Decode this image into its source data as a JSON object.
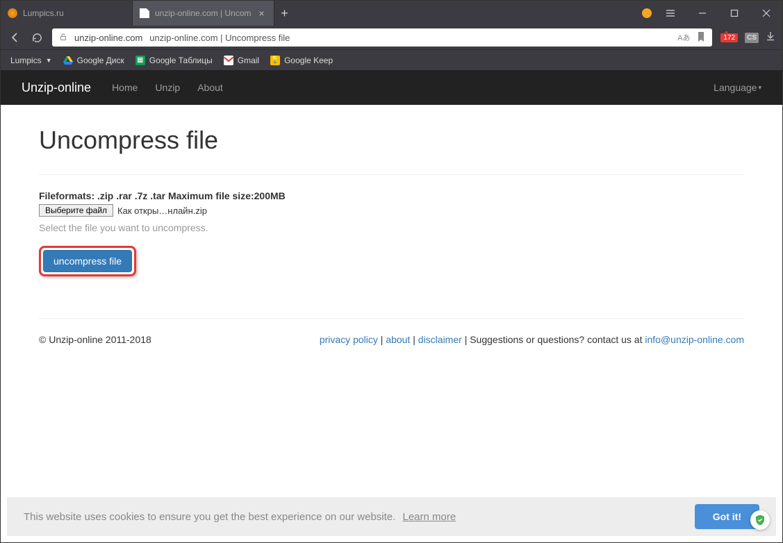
{
  "tabs": [
    {
      "title": "Lumpics.ru",
      "active": false
    },
    {
      "title": "unzip-online.com | Uncom",
      "active": true
    }
  ],
  "url": {
    "domain": "unzip-online.com",
    "title": "unzip-online.com | Uncompress file",
    "translate": "Aあ",
    "badge_count": "172",
    "cs_label": "CS"
  },
  "bookmarks": {
    "b0": "Lumpics",
    "b1": "Google Диск",
    "b2": "Google Таблицы",
    "b3": "Gmail",
    "b4": "Google Keep"
  },
  "nav": {
    "brand": "Unzip-online",
    "home": "Home",
    "unzip": "Unzip",
    "about": "About",
    "language": "Language"
  },
  "page": {
    "heading": "Uncompress file",
    "formats": "Fileformats: .zip .rar .7z .tar Maximum file size:200MB",
    "choose_label": "Выберите файл",
    "chosen_file": "Как откры…нлайн.zip",
    "help": "Select the file you want to uncompress.",
    "submit": "uncompress file"
  },
  "footer": {
    "copyright": "© Unzip-online 2011-2018",
    "privacy": "privacy policy",
    "about": "about",
    "disclaimer": "disclaimer",
    "suggest": " | Suggestions or questions? contact us at ",
    "email": "info@unzip-online.com"
  },
  "cookie": {
    "msg": "This website uses cookies to ensure you get the best experience on our website.",
    "learn": "Learn more",
    "gotit": "Got it!"
  }
}
